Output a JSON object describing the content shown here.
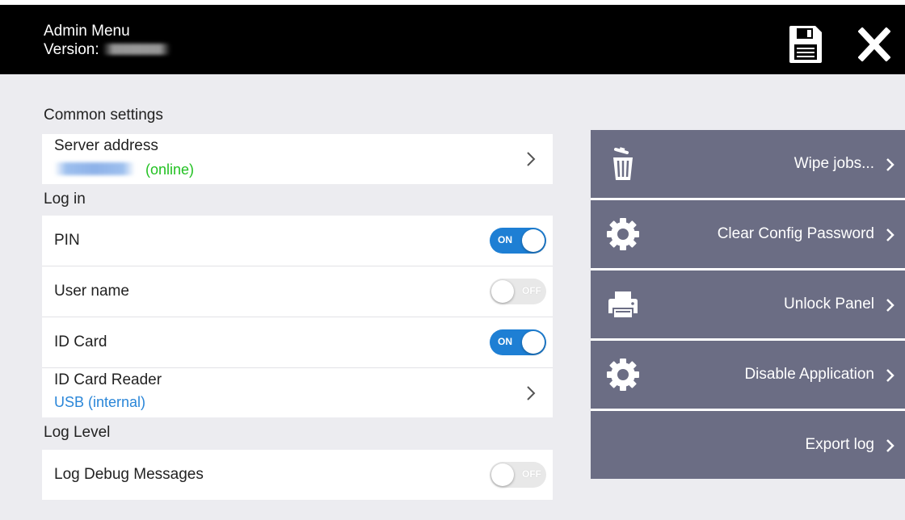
{
  "header": {
    "title": "Admin Menu",
    "version_label": "Version:",
    "version_value_redacted": true
  },
  "sections": {
    "common": {
      "label": "Common settings",
      "server": {
        "label": "Server address",
        "status": "(online)",
        "status_color": "#22c122"
      }
    },
    "login": {
      "label": "Log in",
      "pin": {
        "label": "PIN",
        "state": "ON"
      },
      "username": {
        "label": "User name",
        "state": "OFF"
      },
      "idcard": {
        "label": "ID Card",
        "state": "ON"
      },
      "reader": {
        "label": "ID Card Reader",
        "value": "USB (internal)",
        "value_color": "#2a86d8"
      }
    },
    "loglevel": {
      "label": "Log Level",
      "debug": {
        "label": "Log Debug Messages",
        "state": "OFF"
      }
    }
  },
  "actions": [
    {
      "label": "Wipe jobs...",
      "icon": "trash-icon"
    },
    {
      "label": "Clear Config Password",
      "icon": "gear-icon"
    },
    {
      "label": "Unlock Panel",
      "icon": "printer-icon"
    },
    {
      "label": "Disable Application",
      "icon": "gear-icon"
    },
    {
      "label": "Export log",
      "icon": ""
    }
  ],
  "colors": {
    "topbar": "#000000",
    "background": "#ececf0",
    "toggle_on": "#1e7fd4",
    "action_panel": "#6b6d84"
  }
}
